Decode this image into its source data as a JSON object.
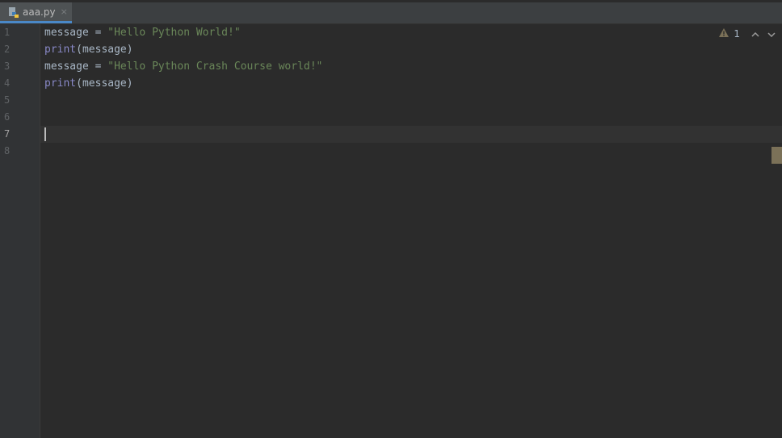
{
  "tab": {
    "filename": "aaa.py",
    "icon": "python-file-icon",
    "close": "×"
  },
  "gutter": {
    "line_numbers": [
      "1",
      "2",
      "3",
      "4",
      "5",
      "6",
      "7",
      "8"
    ],
    "current_line": 7
  },
  "code": {
    "lines": [
      [
        {
          "t": "message",
          "c": "id"
        },
        {
          "t": " = ",
          "c": "id"
        },
        {
          "t": "\"Hello Python World!\"",
          "c": "str"
        }
      ],
      [
        {
          "t": "print",
          "c": "kw"
        },
        {
          "t": "(message)",
          "c": "id"
        }
      ],
      [
        {
          "t": "message",
          "c": "id"
        },
        {
          "t": " = ",
          "c": "id"
        },
        {
          "t": "\"Hello Python Crash Course world!\"",
          "c": "str"
        }
      ],
      [
        {
          "t": "print",
          "c": "kw"
        },
        {
          "t": "(message)",
          "c": "id"
        }
      ],
      [],
      [],
      [],
      []
    ]
  },
  "inspection": {
    "warning_count": "1",
    "icon": "warning-icon",
    "prev": "^",
    "next": "v"
  },
  "colors": {
    "background": "#2b2b2b",
    "gutter": "#313335",
    "keyword": "#8888c6",
    "string": "#6a8759",
    "identifier": "#a9b7c6",
    "tab_accent": "#4a88c7",
    "warning": "#7b7158"
  }
}
